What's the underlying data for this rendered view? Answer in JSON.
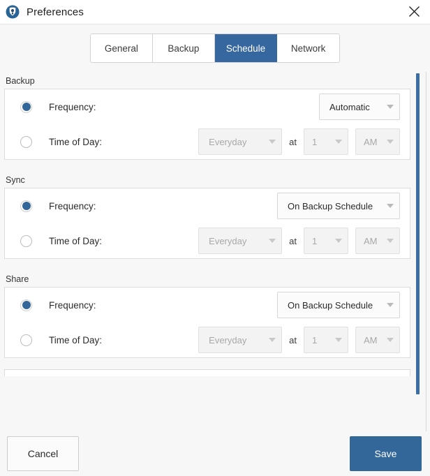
{
  "window": {
    "title": "Preferences",
    "app_icon": "shield-location-icon",
    "close_icon": "close-icon"
  },
  "tabs": [
    {
      "label": "General",
      "active": false
    },
    {
      "label": "Backup",
      "active": false
    },
    {
      "label": "Schedule",
      "active": true
    },
    {
      "label": "Network",
      "active": false
    }
  ],
  "sections": [
    {
      "label": "Backup",
      "frequency": {
        "radio_label": "Frequency:",
        "selected": true,
        "dropdown_value": "Automatic"
      },
      "time_of_day": {
        "radio_label": "Time of Day:",
        "selected": false,
        "day_value": "Everyday",
        "at_label": "at",
        "hour_value": "1",
        "meridiem_value": "AM"
      }
    },
    {
      "label": "Sync",
      "frequency": {
        "radio_label": "Frequency:",
        "selected": true,
        "dropdown_value": "On Backup Schedule"
      },
      "time_of_day": {
        "radio_label": "Time of Day:",
        "selected": false,
        "day_value": "Everyday",
        "at_label": "at",
        "hour_value": "1",
        "meridiem_value": "AM"
      }
    },
    {
      "label": "Share",
      "frequency": {
        "radio_label": "Frequency:",
        "selected": true,
        "dropdown_value": "On Backup Schedule"
      },
      "time_of_day": {
        "radio_label": "Time of Day:",
        "selected": false,
        "day_value": "Everyday",
        "at_label": "at",
        "hour_value": "1",
        "meridiem_value": "AM"
      }
    }
  ],
  "footer": {
    "cancel_label": "Cancel",
    "save_label": "Save"
  },
  "colors": {
    "accent": "#336699",
    "tab_active": "#36679e",
    "scrollbar": "#3a6ea5",
    "background": "#f7f7f7",
    "panel": "#ffffff"
  }
}
